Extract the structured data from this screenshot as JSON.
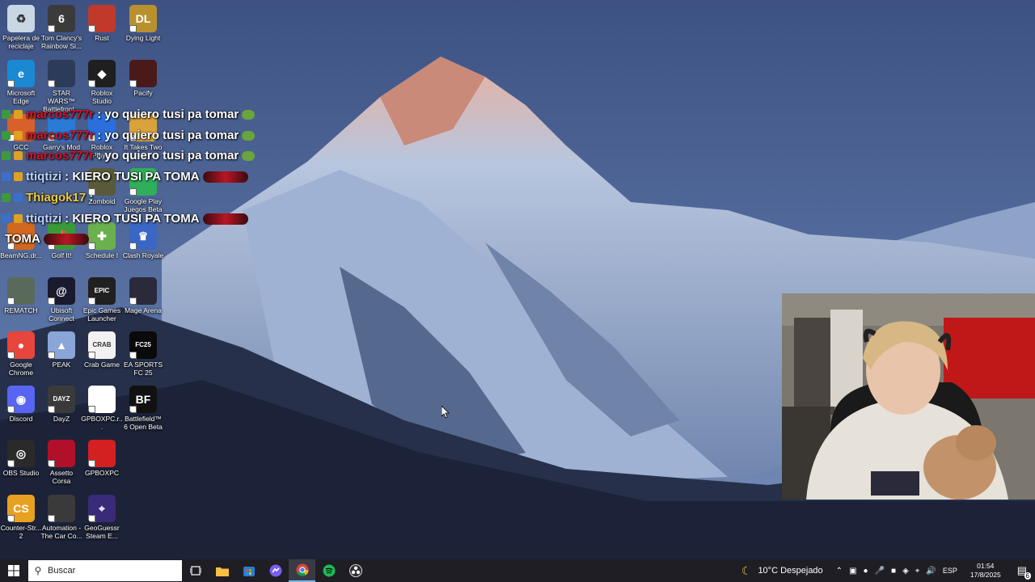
{
  "desktop": {
    "icons": [
      {
        "label": "Papelera de reciclaje",
        "icon": "recycle-bin-icon",
        "color": "#c9d6e3"
      },
      {
        "label": "Tom Clancy's Rainbow Si...",
        "icon": "rainbow-six-icon",
        "color": "#3b3b3b"
      },
      {
        "label": "Rust",
        "icon": "rust-icon",
        "color": "#c0392b"
      },
      {
        "label": "Dying Light",
        "icon": "dying-light-icon",
        "color": "#b8912e"
      },
      {
        "label": "Microsoft Edge",
        "icon": "edge-icon",
        "color": "#1b88d4"
      },
      {
        "label": "STAR WARS™ Battlefront...",
        "icon": "star-wars-icon",
        "color": "#2c3b58"
      },
      {
        "label": "Roblox Studio",
        "icon": "roblox-studio-icon",
        "color": "#1f1f1f"
      },
      {
        "label": "Pacify",
        "icon": "pacify-icon",
        "color": "#4a1a1a"
      },
      {
        "label": "GCC",
        "icon": "gcc-icon",
        "color": "#d8602a"
      },
      {
        "label": "Garry's Mod",
        "icon": "garrys-mod-icon",
        "color": "#2a7bd6"
      },
      {
        "label": "Roblox Player",
        "icon": "roblox-player-icon",
        "color": "#2a6fdc"
      },
      {
        "label": "It Takes Two",
        "icon": "it-takes-two-icon",
        "color": "#d9a33b"
      },
      {
        "label": "Zomboid",
        "icon": "zomboid-icon",
        "color": "#5a5a3a"
      },
      {
        "label": "Google Play Juegos Beta",
        "icon": "google-play-games-icon",
        "color": "#2fae5b"
      },
      {
        "label": "BeamNG.dr...",
        "icon": "beamng-icon",
        "color": "#d06820"
      },
      {
        "label": "Golf It!",
        "icon": "golf-it-icon",
        "color": "#3a9a3a"
      },
      {
        "label": "Schedule I",
        "icon": "schedule-one-icon",
        "color": "#6ab04c"
      },
      {
        "label": "Clash Royale",
        "icon": "clash-royale-icon",
        "color": "#3a66c4"
      },
      {
        "label": "REMATCH",
        "icon": "rematch-icon",
        "color": "#5a6a5a"
      },
      {
        "label": "Ubisoft Connect",
        "icon": "ubisoft-icon",
        "color": "#1a1a2e"
      },
      {
        "label": "Epic Games Launcher",
        "icon": "epic-games-icon",
        "color": "#202020"
      },
      {
        "label": "Mage Arena",
        "icon": "mage-arena-icon",
        "color": "#2a2a3a"
      },
      {
        "label": "Google Chrome",
        "icon": "chrome-icon",
        "color": "#e8453c"
      },
      {
        "label": "PEAK",
        "icon": "peak-icon",
        "color": "#8aa6d8"
      },
      {
        "label": "Crab Game",
        "icon": "crab-game-icon",
        "color": "#f2f2f2"
      },
      {
        "label": "EA SPORTS FC 25",
        "icon": "ea-fc25-icon",
        "color": "#0a0a0a"
      },
      {
        "label": "Discord",
        "icon": "discord-icon",
        "color": "#5865f2"
      },
      {
        "label": "DayZ",
        "icon": "dayz-icon",
        "color": "#3a3a3a"
      },
      {
        "label": "GPBOXPC.r...",
        "icon": "file-icon",
        "color": "#ffffff"
      },
      {
        "label": "Battlefield™ 6 Open Beta",
        "icon": "battlefield-icon",
        "color": "#111111"
      },
      {
        "label": "OBS Studio",
        "icon": "obs-icon",
        "color": "#2a2a2a"
      },
      {
        "label": "Assetto Corsa",
        "icon": "assetto-corsa-icon",
        "color": "#b0102a"
      },
      {
        "label": "GPBOXPC",
        "icon": "gpboxpc-icon",
        "color": "#d42020"
      },
      {
        "label": "Counter-Str... 2",
        "icon": "cs2-icon",
        "color": "#e8a020"
      },
      {
        "label": "Automation - The Car Co...",
        "icon": "automation-icon",
        "color": "#3a3a3a"
      },
      {
        "label": "GeoGuessr Steam E...",
        "icon": "geoguessr-icon",
        "color": "#3a2a7a"
      }
    ],
    "icon_text": {
      "rainbow": "6",
      "rust": "",
      "dying": "DL",
      "epic": "EPIC",
      "crab": "CRAB GAME",
      "fc25": "FC25",
      "dayz": "DAYZ",
      "bf": "BF"
    }
  },
  "chat": [
    {
      "user": "marcos777r",
      "msg": ": yo quiero tusi pa tomar",
      "user_class": "chat-user-red",
      "badges": [
        "#3c9a3c",
        "#e0a020"
      ],
      "emote": "green"
    },
    {
      "user": "marcos777r",
      "msg": ": yo quiero tusi pa tomar",
      "user_class": "chat-user-red",
      "badges": [
        "#3c9a3c",
        "#e0a020"
      ],
      "emote": "green"
    },
    {
      "user": "marcos777r",
      "msg": ": yo quiero tusi pa tomar",
      "user_class": "chat-user-red",
      "badges": [
        "#3c9a3c",
        "#e0a020"
      ],
      "emote": "green"
    },
    {
      "user": "ttiqtizi",
      "msg": ": KIERO TUSI PA TOMA",
      "user_class": "chat-user-lblue",
      "badges": [
        "#3a70c8",
        "#e0a020"
      ],
      "emote": "red"
    },
    {
      "user": "Thiagok17",
      "msg": ":",
      "user_class": "chat-user-yel",
      "badges": [
        "#3c9a3c",
        "#3a70c8"
      ],
      "emote": ""
    },
    {
      "user": "ttiqtizi",
      "msg": ": KIERO TUSI PA TOMA",
      "user_class": "chat-user-lblue",
      "badges": [
        "#3a70c8",
        "#e0a020"
      ],
      "emote": "red"
    },
    {
      "user": "",
      "msg": "TOMA",
      "user_class": "chat-user-lblue",
      "badges": [],
      "emote": "red"
    }
  ],
  "taskbar": {
    "search_placeholder": "Buscar",
    "weather": "10°C  Despejado",
    "language": "ESP",
    "time": "01:54",
    "date": "17/8/2025",
    "notifications": "6"
  }
}
